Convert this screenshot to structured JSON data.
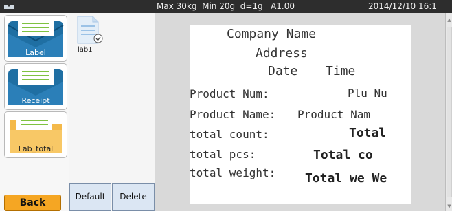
{
  "status_bar": {
    "scale_info": "Max 30kg  Min 20g  d=1g   A1.00",
    "datetime": "2014/12/10  16:1"
  },
  "categories": [
    {
      "label": "Label",
      "icon": "envelope-icon"
    },
    {
      "label": "Receipt",
      "icon": "envelope-icon"
    },
    {
      "label": "Lab_total",
      "icon": "folder-icon"
    }
  ],
  "files": [
    {
      "name": "lab1",
      "icon": "document-check-icon"
    }
  ],
  "preview": {
    "company": "Company Name",
    "address": "Address",
    "date": "Date",
    "time": "Time",
    "rows": [
      {
        "label": "Product Num:",
        "value": "Plu Nu"
      },
      {
        "label": "Product Name:",
        "value": "Product Nam"
      },
      {
        "label": "total count:",
        "value": "Total"
      },
      {
        "label": "total pcs:",
        "value": "Total co"
      },
      {
        "label": "total weight:",
        "value": "Total we We"
      }
    ]
  },
  "buttons": {
    "back": "Back",
    "default": "Default",
    "delete": "Delete"
  },
  "colors": {
    "back_button": "#f5a623",
    "action_buttons": "#dbe6f3",
    "category_icon": "#1f6fa3",
    "folder_icon": "#f4b94a"
  }
}
